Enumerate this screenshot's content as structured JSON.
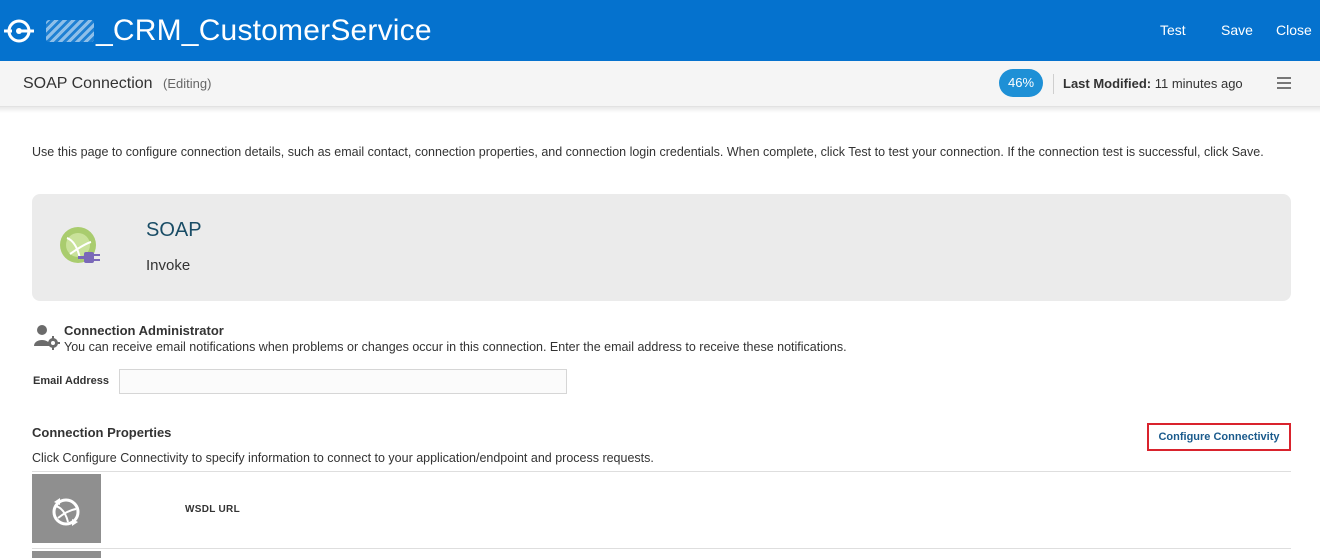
{
  "header": {
    "title": "_CRM_CustomerService",
    "actions": {
      "test": "Test",
      "save": "Save",
      "close": "Close"
    },
    "colors": {
      "bar": "#0572ce"
    }
  },
  "subheader": {
    "page_title": "SOAP Connection",
    "status": "(Editing)",
    "progress": "46%",
    "last_modified_label": "Last Modified:",
    "last_modified_value": "11 minutes ago"
  },
  "intro": "Use this page to configure connection details, such as email contact, connection properties, and connection login credentials. When complete, click Test to test your connection. If the connection test is successful, click Save.",
  "adapter": {
    "name": "SOAP",
    "role": "Invoke",
    "icon": "soap-adapter-icon"
  },
  "admin": {
    "title": "Connection Administrator",
    "description": "You can receive email notifications when problems or changes occur in this connection. Enter the email address to receive these notifications.",
    "email_label": "Email Address",
    "email_value": ""
  },
  "properties": {
    "title": "Connection Properties",
    "description": "Click Configure Connectivity to specify information to connect to your application/endpoint and process requests.",
    "configure_button": "Configure Connectivity",
    "items": [
      {
        "label": "WSDL URL",
        "icon": "refresh-globe-icon"
      }
    ]
  }
}
